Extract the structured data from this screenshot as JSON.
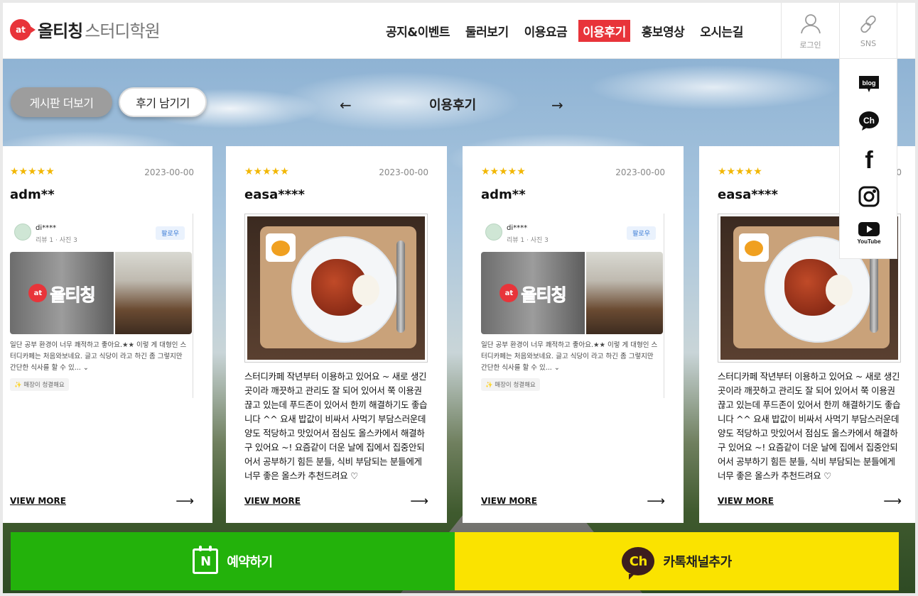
{
  "brand": {
    "badge": "at",
    "name": "올티칭",
    "sub": "스터디학원"
  },
  "nav": [
    {
      "label": "공지&이벤트",
      "active": false
    },
    {
      "label": "둘러보기",
      "active": false
    },
    {
      "label": "이용요금",
      "active": false
    },
    {
      "label": "이용후기",
      "active": true
    },
    {
      "label": "홍보영상",
      "active": false
    },
    {
      "label": "오시는길",
      "active": false
    }
  ],
  "header_buttons": {
    "login": "로그인",
    "sns": "SNS"
  },
  "section": {
    "more_label": "게시판 더보기",
    "write_label": "후기 남기기",
    "title": "이용후기",
    "prev": "←",
    "next": "→"
  },
  "cards": [
    {
      "stars": "★★★★★",
      "date": "2023-00-00",
      "user": "adm**",
      "embed": {
        "name": "di****",
        "meta": "리뷰 1 · 사진 3",
        "follow": "팔로우",
        "sign_badge": "at",
        "sign_text": "올티칭",
        "text": "일단 공부 환경이 너무 쾌적하고 좋아요.★★ 이렇 게 대형인 스터디카페는 처음와보네요. 글고 식당이 라고 하긴 좀 그렇지만 간단한 식사를 할 수 있... ⌄",
        "tag": "✨ 매장이 청결해요"
      },
      "view_more": "VIEW MORE",
      "arrow": "⟶"
    },
    {
      "stars": "★★★★★",
      "date": "2023-00-00",
      "user": "easa****",
      "review": "스터디카페 작년부터 이용하고 있어요 ~ 새로 생긴 곳이라 깨끗하고 관리도 잘 되어 있어서 쭉 이용권 끊고 있는데 푸드존이 있어서 한끼 해결하기도 좋습니다 ^^ 요새 밥값이 비싸서 사먹기 부담스러운데 양도 적당하고 맛있어서 점심도 올스카에서 해결하구 있어요 ~! 요즘같이 더운 날에 집에서 집중안되어서 공부하기 힘든 분들, 식비 부담되는 분들에게 너무 좋은 올스카 추천드려요 ♡",
      "view_more": "VIEW MORE",
      "arrow": "⟶"
    },
    {
      "stars": "★★★★★",
      "date": "2023-00-00",
      "user": "adm**",
      "embed": {
        "name": "di****",
        "meta": "리뷰 1 · 사진 3",
        "follow": "팔로우",
        "sign_badge": "at",
        "sign_text": "올티칭",
        "text": "일단 공부 환경이 너무 쾌적하고 좋아요.★★ 이렇 게 대형인 스터디카페는 처음와보네요. 글고 식당이 라고 하긴 좀 그렇지만 간단한 식사를 할 수 있... ⌄",
        "tag": "✨ 매장이 청결해요"
      },
      "view_more": "VIEW MORE",
      "arrow": "⟶"
    },
    {
      "stars": "★★★★★",
      "date": "2023-00-00",
      "user": "easa****",
      "review": "스터디카페 작년부터 이용하고 있어요 ~ 새로 생긴 곳이라 깨끗하고 관리도 잘 되어 있어서 쭉 이용권 끊고 있는데 푸드존이 있어서 한끼 해결하기도 좋습니다 ^^ 요새 밥값이 비싸서 사먹기 부담스러운데 양도 적당하고 맛있어서 점심도 올스카에서 해결하구 있어요 ~! 요즘같이 더운 날에 집에서 집중안되어서 공부하기 힘든 분들, 식비 부담되는 분들에게 너무 좋은 올스카 추천드려요 ♡",
      "view_more": "VIEW MORE",
      "arrow": "⟶"
    }
  ],
  "sns_menu": [
    {
      "icon": "blog-icon",
      "label": "blog"
    },
    {
      "icon": "kakao-channel-icon",
      "label": "Ch"
    },
    {
      "icon": "facebook-icon",
      "label": "f"
    },
    {
      "icon": "instagram-icon",
      "label": ""
    },
    {
      "icon": "youtube-icon",
      "label": "YouTube"
    }
  ],
  "bottom_bar": {
    "book": {
      "icon_letter": "N",
      "label": "예약하기"
    },
    "kakao": {
      "icon_letter": "Ch",
      "label": "카톡채널추가"
    }
  },
  "colors": {
    "accent": "#e8343a",
    "naver_green": "#23b20b",
    "kakao_yellow": "#fae300",
    "star": "#f2b705"
  }
}
